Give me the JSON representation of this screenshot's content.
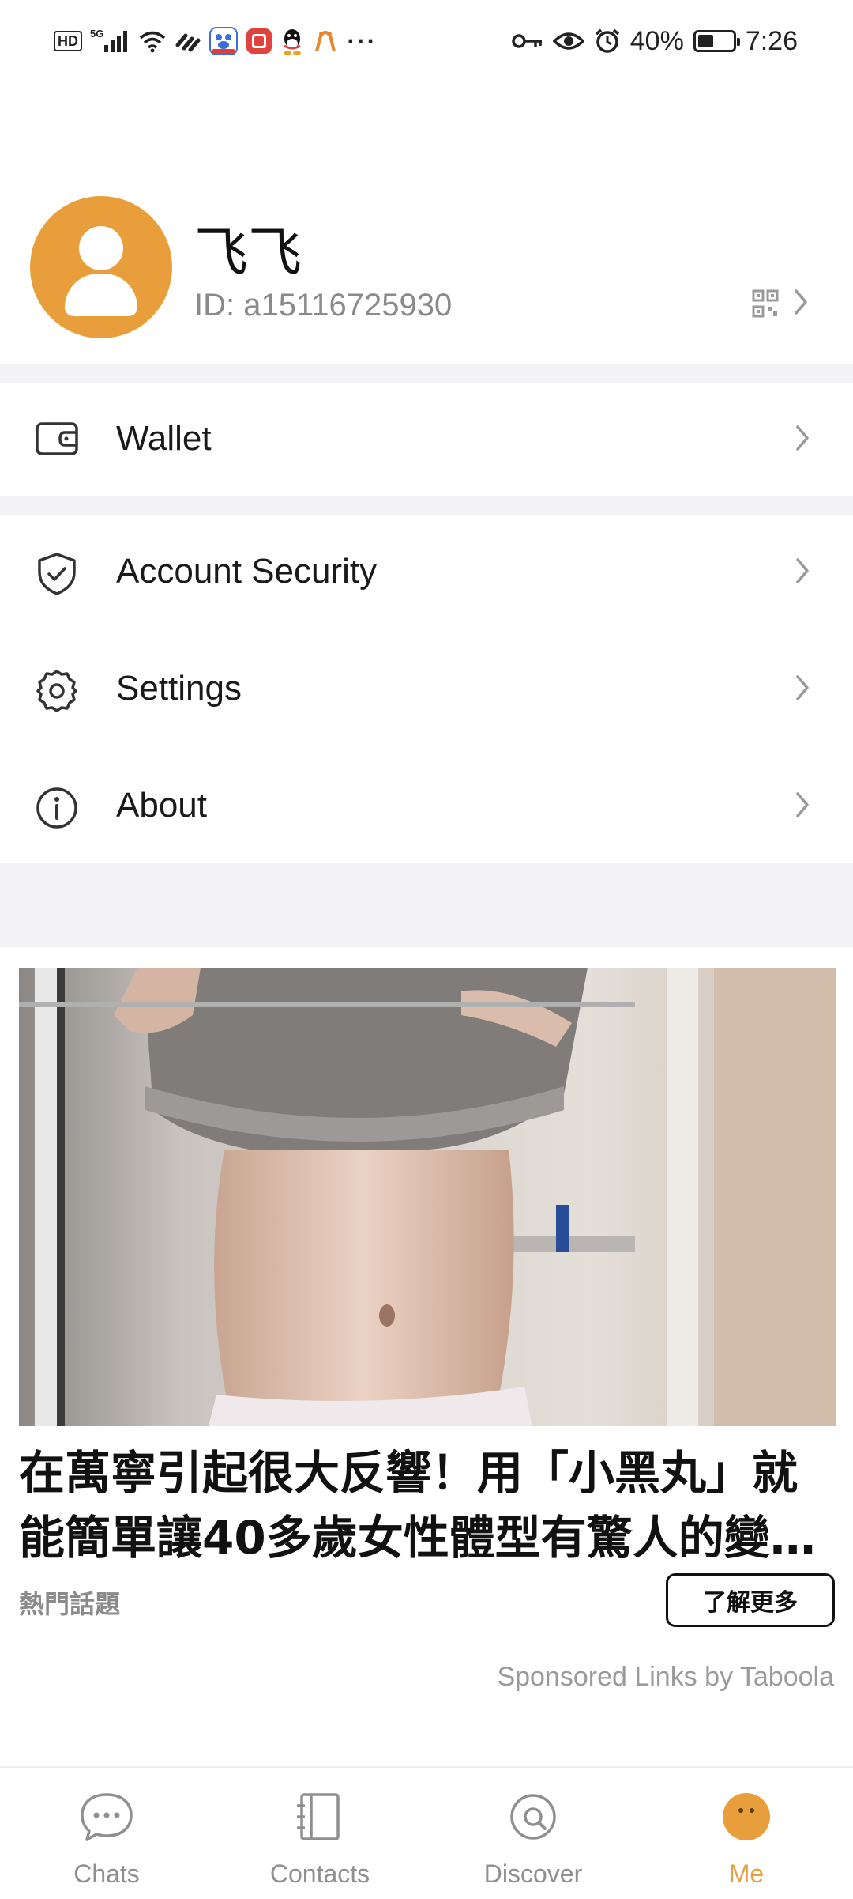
{
  "status_bar": {
    "left_icons": [
      "hd-icon",
      "5g-signal-icon",
      "wifi-icon",
      "data-saver-icon",
      "baidu-app-icon",
      "red-app-icon",
      "qq-icon",
      "app-notification-icon",
      "more-dots-icon"
    ],
    "hd_label": "HD",
    "network_label": "5G",
    "dots": "···",
    "right_icons": [
      "key-icon",
      "eye-icon",
      "alarm-icon",
      "battery-icon"
    ],
    "battery_percent": "40%",
    "time": "7:26"
  },
  "profile": {
    "name": "飞飞",
    "id_text": "ID: a15116725930",
    "avatar_color": "#E89E3A"
  },
  "menu": {
    "wallet": "Wallet",
    "account_security": "Account Security",
    "settings": "Settings",
    "about": "About"
  },
  "ad": {
    "title": "在萬寧引起很大反響！用「小黑丸」就能簡單讓40多歲女性體型有驚人的變…",
    "source": "熱門話題",
    "cta": "了解更多",
    "sponsor": "Sponsored Links by Taboola"
  },
  "bottom_nav": {
    "items": [
      {
        "label": "Chats",
        "icon": "chat-bubble-icon",
        "active": false
      },
      {
        "label": "Contacts",
        "icon": "contacts-book-icon",
        "active": false
      },
      {
        "label": "Discover",
        "icon": "discover-compass-icon",
        "active": false
      },
      {
        "label": "Me",
        "icon": "me-face-icon",
        "active": true
      }
    ],
    "active_color": "#E89E3A",
    "inactive_color": "#8f8f8f"
  }
}
